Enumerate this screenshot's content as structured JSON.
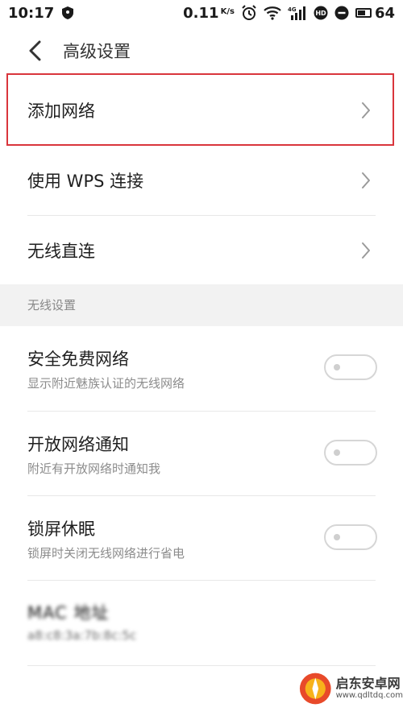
{
  "status_bar": {
    "time": "10:17",
    "net_speed": "0.11",
    "net_unit": "K/s",
    "network_type": "4G",
    "battery_level": "64",
    "battery_fraction": 0.64
  },
  "header": {
    "title": "高级设置"
  },
  "rows": [
    {
      "label": "添加网络"
    },
    {
      "label": "使用 WPS 连接"
    },
    {
      "label": "无线直连"
    }
  ],
  "section": {
    "label": "无线设置"
  },
  "toggles": [
    {
      "title": "安全免费网络",
      "subtitle": "显示附近魅族认证的无线网络",
      "on": false
    },
    {
      "title": "开放网络通知",
      "subtitle": "附近有开放网络时通知我",
      "on": false
    },
    {
      "title": "锁屏休眠",
      "subtitle": "锁屏时关闭无线网络进行省电",
      "on": false
    }
  ],
  "mac": {
    "title": "MAC 地址",
    "value": "a8:c8:3a:7b:8c:5c"
  },
  "watermark": {
    "name": "启东安卓网",
    "url": "www.qdltdq.com"
  },
  "colors": {
    "highlight": "#d9353c",
    "toggle_border": "#d6d6d6",
    "section_bg": "#f2f2f2"
  }
}
